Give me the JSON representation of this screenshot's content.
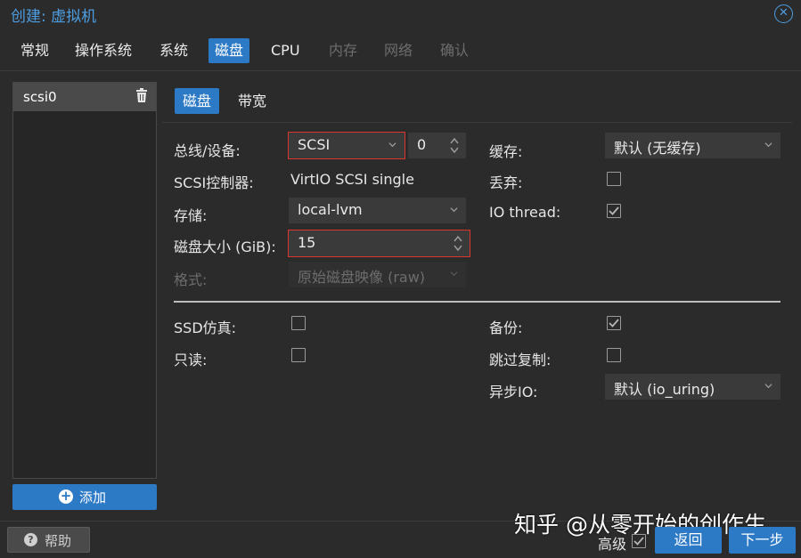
{
  "window": {
    "title": "创建: 虚拟机",
    "close_icon": "close-icon"
  },
  "tabs": [
    {
      "label": "常规",
      "state": "normal"
    },
    {
      "label": "操作系统",
      "state": "normal"
    },
    {
      "label": "系统",
      "state": "normal"
    },
    {
      "label": "磁盘",
      "state": "active"
    },
    {
      "label": "CPU",
      "state": "normal"
    },
    {
      "label": "内存",
      "state": "disabled"
    },
    {
      "label": "网络",
      "state": "disabled"
    },
    {
      "label": "确认",
      "state": "disabled"
    }
  ],
  "disk_list": {
    "items": [
      {
        "label": "scsi0",
        "icon": "trash-icon"
      }
    ],
    "add_label": "添加"
  },
  "subtabs": [
    {
      "label": "磁盘",
      "state": "active"
    },
    {
      "label": "带宽",
      "state": "normal"
    }
  ],
  "form": {
    "bus_device": {
      "label": "总线/设备:",
      "bus": "SCSI",
      "device": "0"
    },
    "scsi_controller": {
      "label": "SCSI控制器:",
      "value": "VirtIO SCSI single"
    },
    "storage": {
      "label": "存储:",
      "value": "local-lvm"
    },
    "disk_size": {
      "label": "磁盘大小 (GiB):",
      "value": "15"
    },
    "format": {
      "label": "格式:",
      "value": "原始磁盘映像 (raw)"
    },
    "cache": {
      "label": "缓存:",
      "value": "默认 (无缓存)"
    },
    "discard": {
      "label": "丢弃:",
      "checked": false
    },
    "io_thread": {
      "label": "IO thread:",
      "checked": true
    },
    "ssd": {
      "label": "SSD仿真:",
      "checked": false
    },
    "readonly": {
      "label": "只读:",
      "checked": false
    },
    "backup": {
      "label": "备份:",
      "checked": true
    },
    "skip_replication": {
      "label": "跳过复制:",
      "checked": false
    },
    "async_io": {
      "label": "异步IO:",
      "value": "默认 (io_uring)"
    }
  },
  "footer": {
    "help_label": "帮助",
    "advanced_label": "高级",
    "advanced_checked": true,
    "back_label": "返回",
    "next_label": "下一步"
  },
  "watermark": "知乎 @从零开始的创作生",
  "colors": {
    "accent": "#2c79c6",
    "title": "#4d9de0",
    "highlight": "#d9362e",
    "background": "#2b2b2b"
  }
}
